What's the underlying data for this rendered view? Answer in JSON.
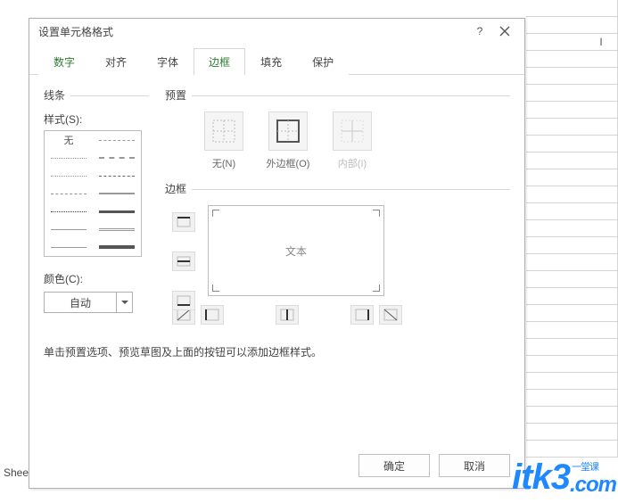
{
  "app": {
    "sheet_tab": "Sheet",
    "column_letter": "I"
  },
  "dialog": {
    "title": "设置单元格格式",
    "help_tooltip": "?",
    "tabs": [
      "数字",
      "对齐",
      "字体",
      "边框",
      "填充",
      "保护"
    ],
    "active_tab_index": 3,
    "lines": {
      "group_label": "线条",
      "style_label": "样式(S):",
      "none_label": "无",
      "color_label": "颜色(C):",
      "color_value": "自动"
    },
    "presets": {
      "group_label": "预置",
      "items": [
        {
          "label": "无(N)"
        },
        {
          "label": "外边框(O)"
        },
        {
          "label": "内部(I)",
          "disabled": true
        }
      ]
    },
    "border": {
      "group_label": "边框",
      "preview_text": "文本"
    },
    "hint": "单击预置选项、预览草图及上面的按钮可以添加边框样式。",
    "buttons": {
      "ok": "确定",
      "cancel": "取消"
    }
  },
  "watermark": {
    "brand": "itk3",
    "suffix": ".com",
    "top_small": "一堂课"
  }
}
